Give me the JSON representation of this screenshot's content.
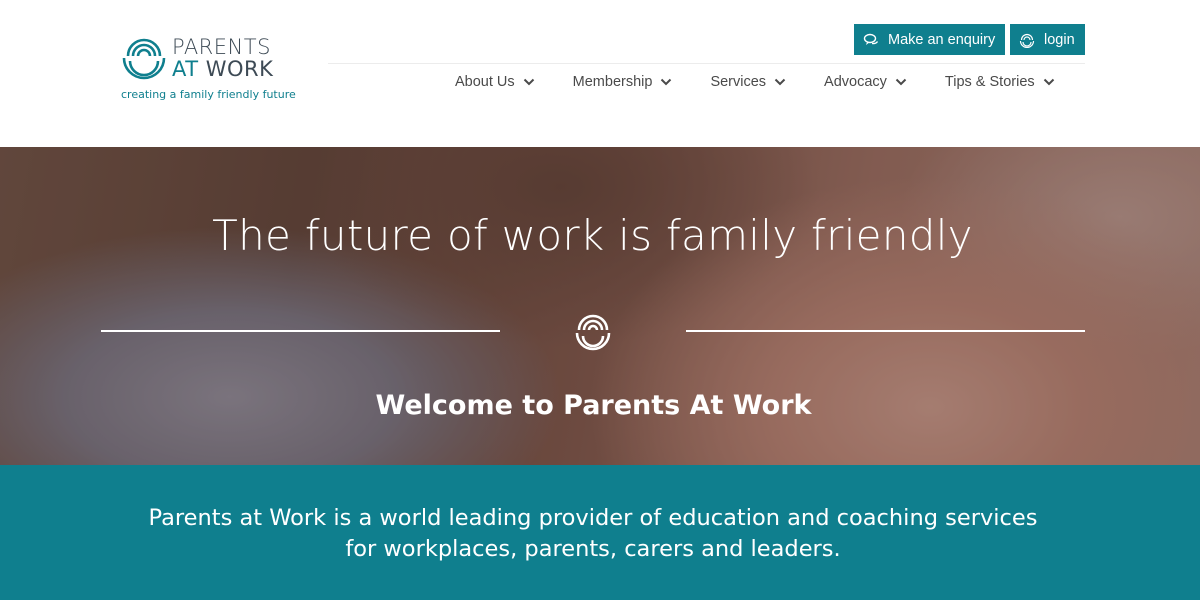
{
  "brand": {
    "word1": "PARENTS",
    "word2_at": "AT",
    "word2_work": "WORK",
    "tagline": "creating a family friendly future",
    "color": "#0f7f8e"
  },
  "header": {
    "enquiry_label": "Make an enquiry",
    "enquiry_icon": "chat-bubbles-icon",
    "login_label": "login",
    "login_icon": "logo-mark-icon"
  },
  "nav": {
    "items": [
      {
        "label": "About Us"
      },
      {
        "label": "Membership"
      },
      {
        "label": "Services"
      },
      {
        "label": "Advocacy"
      },
      {
        "label": "Tips & Stories"
      }
    ]
  },
  "hero": {
    "title": "The future of work is family friendly",
    "subtitle": "Welcome to Parents At Work"
  },
  "band": {
    "line1": "Parents at Work is a world leading provider of education and coaching services",
    "line2": "for workplaces, parents, carers and leaders."
  }
}
